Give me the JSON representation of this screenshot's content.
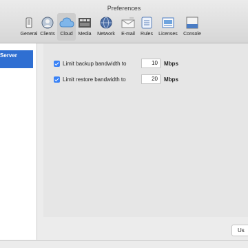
{
  "window": {
    "title": "Preferences"
  },
  "toolbar": {
    "items": [
      {
        "label": "General",
        "icon": "phone-icon"
      },
      {
        "label": "Clients",
        "icon": "clients-icon"
      },
      {
        "label": "Cloud",
        "icon": "cloud-icon",
        "selected": true
      },
      {
        "label": "Media",
        "icon": "media-icon"
      },
      {
        "label": "Network",
        "icon": "globe-icon"
      },
      {
        "label": "E-mail",
        "icon": "email-icon"
      },
      {
        "label": "Rules",
        "icon": "rules-icon"
      },
      {
        "label": "Licenses",
        "icon": "licenses-icon"
      },
      {
        "label": "Console",
        "icon": "console-icon"
      }
    ]
  },
  "sidebar": {
    "items": [
      {
        "label": "Server",
        "selected": true
      }
    ]
  },
  "settings": {
    "backup": {
      "label": "Limit backup bandwidth to",
      "value": "10",
      "unit": "Mbps",
      "checked": true
    },
    "restore": {
      "label": "Limit restore bandwidth to",
      "value": "20",
      "unit": "Mbps",
      "checked": true
    }
  },
  "footer": {
    "button_label": "Us"
  },
  "colors": {
    "accent": "#2f6fd2",
    "checkbox": "#3a82f6"
  }
}
